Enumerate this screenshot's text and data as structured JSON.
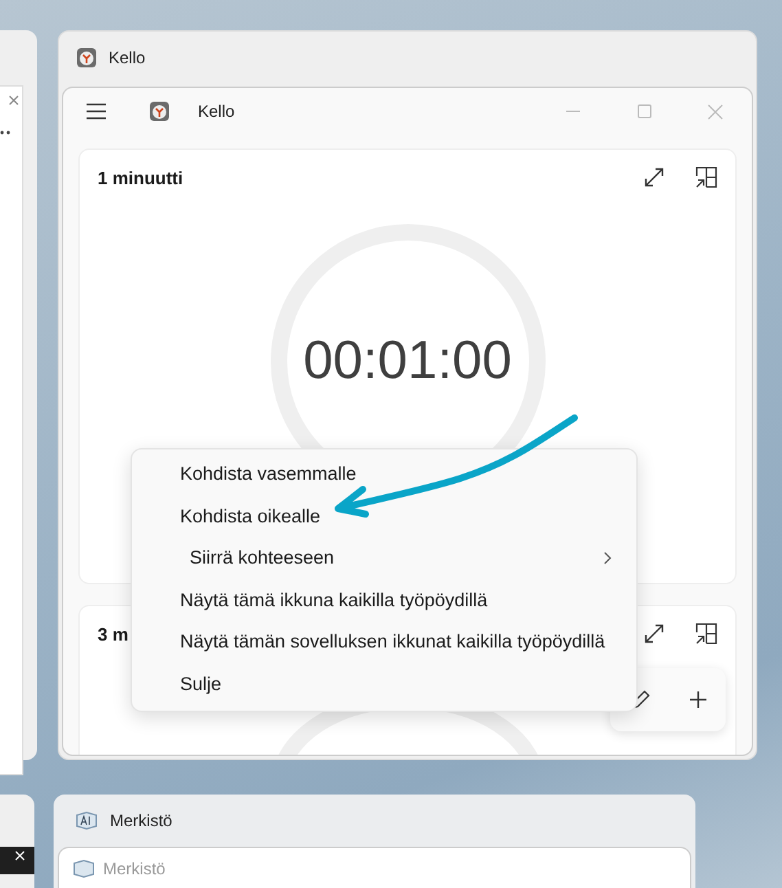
{
  "kello_window": {
    "title": "Kello",
    "app": {
      "title": "Kello",
      "timers": [
        {
          "title": "1 minuutti",
          "time": "00:01:00"
        },
        {
          "title": "3 m"
        }
      ]
    }
  },
  "context_menu": {
    "items": [
      {
        "label": "Kohdista vasemmalle",
        "kind": "item"
      },
      {
        "label": "Kohdista oikealle",
        "kind": "item"
      },
      {
        "label": "Siirrä kohteeseen",
        "kind": "submenu"
      },
      {
        "label": "Näytä tämä ikkuna kaikilla työpöydillä",
        "kind": "item"
      },
      {
        "label": "Näytä tämän sovelluksen ikkunat kaikilla työpöydillä",
        "kind": "item"
      },
      {
        "label": "Sulje",
        "kind": "item"
      }
    ]
  },
  "merkisto_window": {
    "title": "Merkistö",
    "app_title": "Merkistö"
  }
}
